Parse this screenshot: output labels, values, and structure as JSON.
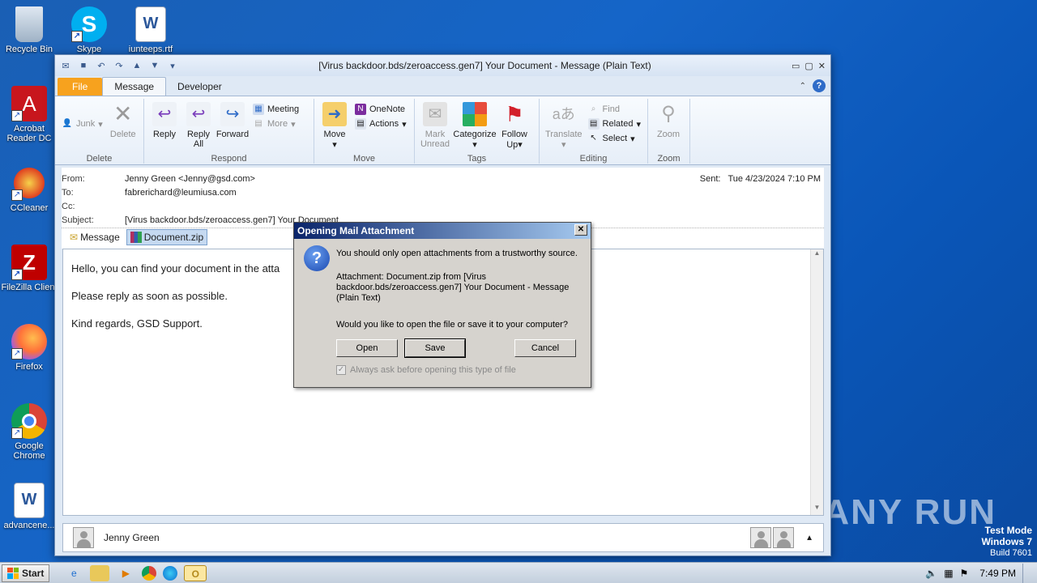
{
  "desktop": {
    "icons": [
      {
        "label": "Recycle Bin"
      },
      {
        "label": "Skype"
      },
      {
        "label": "iunteeps.rtf"
      },
      {
        "label": "Acrobat Reader DC"
      },
      {
        "label": "CCleaner"
      },
      {
        "label": "FileZilla Client"
      },
      {
        "label": "Firefox"
      },
      {
        "label": "Google Chrome"
      },
      {
        "label": "advancene..."
      }
    ],
    "watermark": "ANY RUN",
    "test_mode": {
      "line1": "Test Mode",
      "line2": "Windows 7",
      "line3": "Build 7601"
    }
  },
  "window": {
    "title": "[Virus backdoor.bds/zeroaccess.gen7] Your Document  -  Message (Plain Text)",
    "tabs": [
      {
        "label": "File"
      },
      {
        "label": "Message"
      },
      {
        "label": "Developer"
      }
    ],
    "help_glyph": "?"
  },
  "ribbon": {
    "delete": {
      "label": "Delete",
      "junk": "Junk",
      "delete_btn": "Delete"
    },
    "respond": {
      "label": "Respond",
      "reply": "Reply",
      "reply_all_1": "Reply",
      "reply_all_2": "All",
      "forward": "Forward",
      "meeting": "Meeting",
      "more": "More"
    },
    "move": {
      "label": "Move",
      "move_btn": "Move",
      "onenote": "OneNote",
      "actions": "Actions"
    },
    "tags": {
      "label": "Tags",
      "mark_unread_1": "Mark",
      "mark_unread_2": "Unread",
      "categorize": "Categorize",
      "follow_up_1": "Follow",
      "follow_up_2": "Up"
    },
    "editing": {
      "label": "Editing",
      "translate": "Translate",
      "find": "Find",
      "related": "Related",
      "select": "Select"
    },
    "zoom": {
      "label": "Zoom",
      "zoom_btn": "Zoom"
    }
  },
  "message": {
    "from_label": "From:",
    "from": "Jenny Green <Jenny@gsd.com>",
    "to_label": "To:",
    "to": "fabrerichard@leumiusa.com",
    "cc_label": "Cc:",
    "subject_label": "Subject:",
    "subject": "[Virus backdoor.bds/zeroaccess.gen7] Your Document",
    "sent_label": "Sent:",
    "sent": "Tue 4/23/2024 7:10 PM",
    "attach_message": "Message",
    "attach_file": "Document.zip",
    "body": [
      "Hello, you can find your document in the atta",
      "Please reply as soon as possible.",
      "Kind regards, GSD Support."
    ]
  },
  "people_pane": {
    "name": "Jenny Green"
  },
  "dialog": {
    "title": "Opening Mail Attachment",
    "close": "✕",
    "warning": "You should only open attachments from a trustworthy source.",
    "attachment_line1": "Attachment: Document.zip from [Virus",
    "attachment_line2": "backdoor.bds/zeroaccess.gen7] Your Document - Message",
    "attachment_line3": "(Plain Text)",
    "question": "Would you like to open the file or save it to your computer?",
    "open_label": "Open",
    "save_label": "Save",
    "cancel_label": "Cancel",
    "checkbox_label": "Always ask before opening this type of file",
    "checkbox_checked": true
  },
  "taskbar": {
    "start_label": "Start",
    "clock": "7:49 PM"
  }
}
